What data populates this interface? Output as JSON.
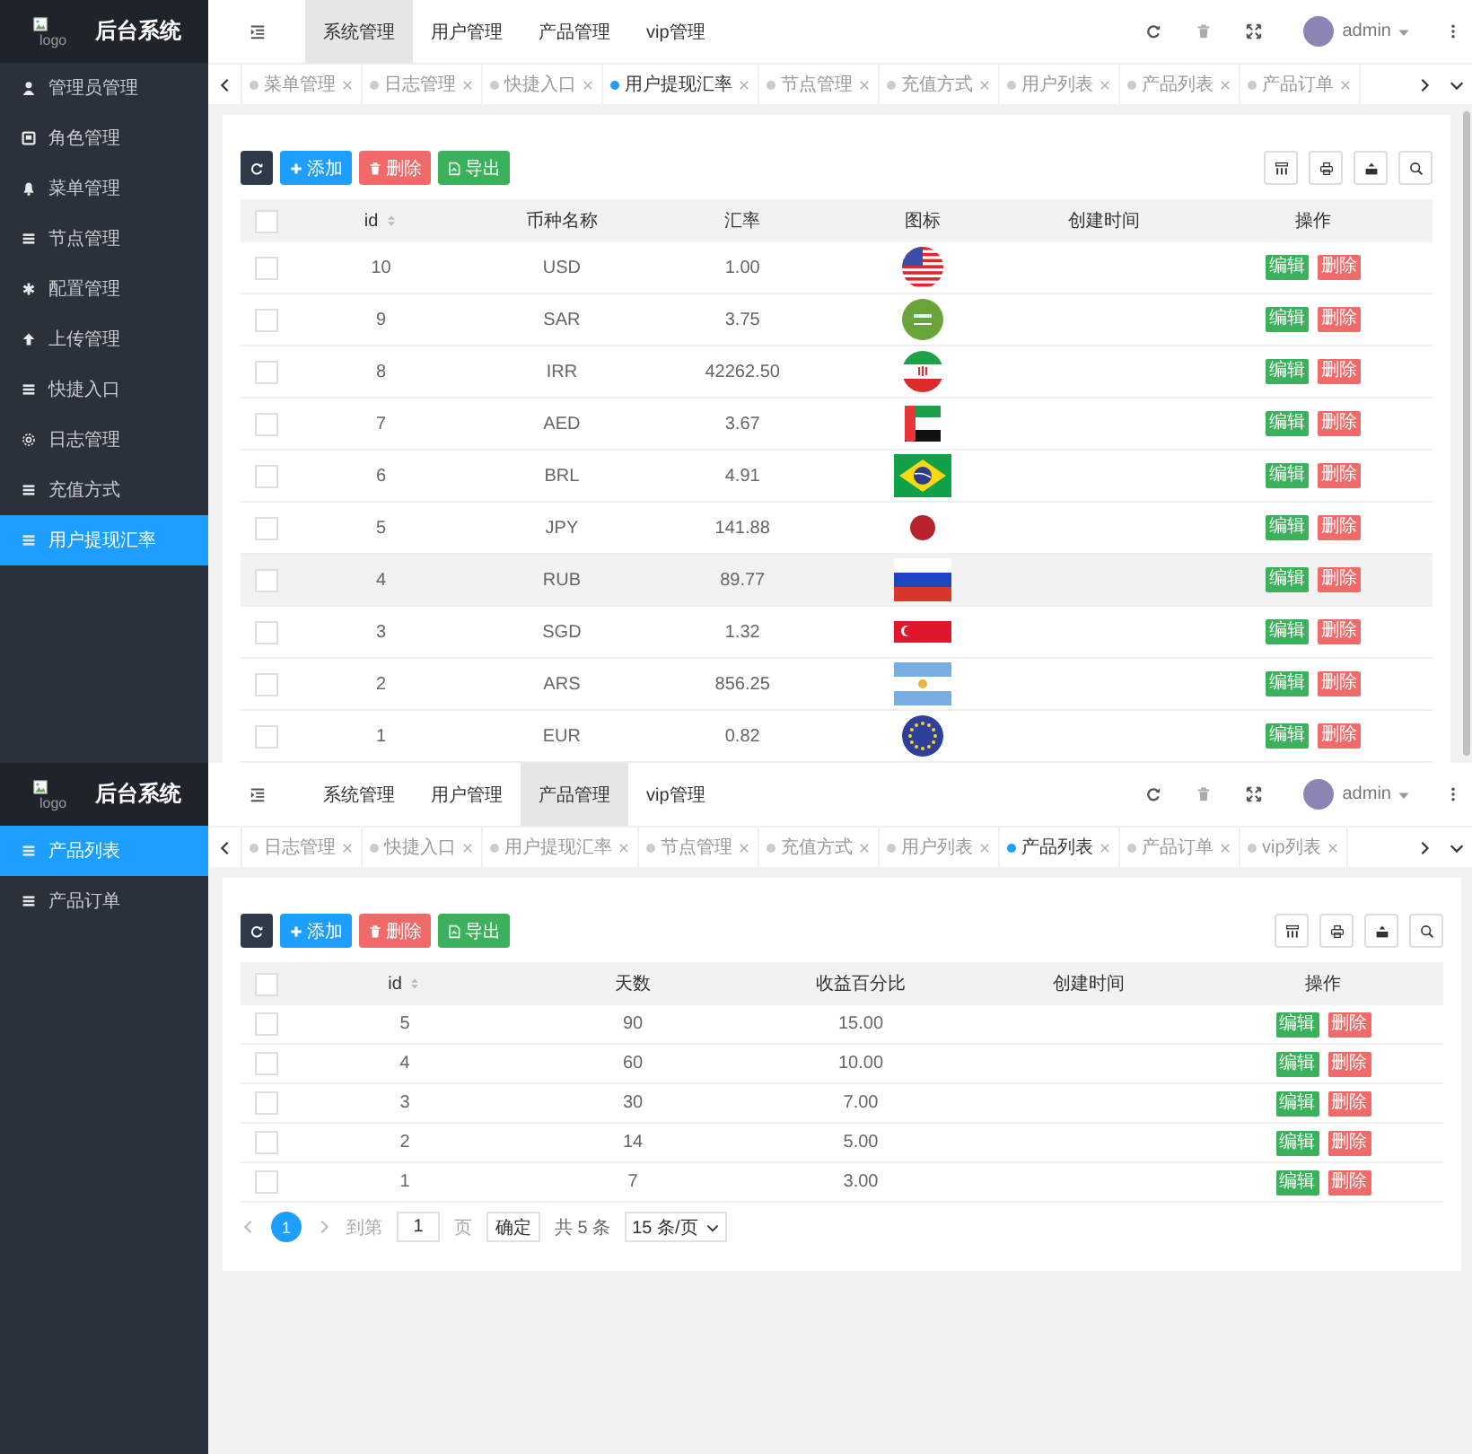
{
  "screens": [
    {
      "brand": {
        "logo_alt": "logo",
        "title": "后台系统"
      },
      "top_nav": [
        {
          "label": "系统管理",
          "selected": true
        },
        {
          "label": "用户管理",
          "selected": false
        },
        {
          "label": "产品管理",
          "selected": false
        },
        {
          "label": "vip管理",
          "selected": false
        }
      ],
      "user": {
        "name": "admin"
      },
      "sidebar": {
        "items": [
          {
            "label": "管理员管理",
            "selected": false
          },
          {
            "label": "角色管理",
            "selected": false
          },
          {
            "label": "菜单管理",
            "selected": false
          },
          {
            "label": "节点管理",
            "selected": false
          },
          {
            "label": "配置管理",
            "selected": false
          },
          {
            "label": "上传管理",
            "selected": false
          },
          {
            "label": "快捷入口",
            "selected": false
          },
          {
            "label": "日志管理",
            "selected": false
          },
          {
            "label": "充值方式",
            "selected": false
          },
          {
            "label": "用户提现汇率",
            "selected": true
          }
        ]
      },
      "tabs": [
        {
          "label": "菜单管理",
          "selected": false
        },
        {
          "label": "日志管理",
          "selected": false
        },
        {
          "label": "快捷入口",
          "selected": false
        },
        {
          "label": "用户提现汇率",
          "selected": true
        },
        {
          "label": "节点管理",
          "selected": false
        },
        {
          "label": "充值方式",
          "selected": false
        },
        {
          "label": "用户列表",
          "selected": false
        },
        {
          "label": "产品列表",
          "selected": false
        },
        {
          "label": "产品订单",
          "selected": false
        }
      ],
      "toolbar": {
        "buttons": [
          {
            "label": "添加",
            "kind": "add"
          },
          {
            "label": "删除",
            "kind": "delete"
          },
          {
            "label": "导出",
            "kind": "export"
          }
        ]
      },
      "table": {
        "select_all": false,
        "columns": [
          {
            "label": "id",
            "kind": "id"
          },
          {
            "label": "币种名称",
            "kind": "text"
          },
          {
            "label": "汇率",
            "kind": "text"
          },
          {
            "label": "图标",
            "kind": "flag"
          },
          {
            "label": "创建时间",
            "kind": "date"
          },
          {
            "label": "操作",
            "kind": "actions"
          }
        ],
        "rows": [
          {
            "cells": [
              "10",
              "USD",
              "1.00"
            ],
            "checked": false,
            "highlighted": false,
            "actions": [
              "编辑",
              "删除"
            ]
          },
          {
            "cells": [
              "9",
              "SAR",
              "3.75"
            ],
            "checked": false,
            "highlighted": false,
            "actions": [
              "编辑",
              "删除"
            ]
          },
          {
            "cells": [
              "8",
              "IRR",
              "42262.50"
            ],
            "checked": false,
            "highlighted": false,
            "actions": [
              "编辑",
              "删除"
            ]
          },
          {
            "cells": [
              "7",
              "AED",
              "3.67"
            ],
            "checked": false,
            "highlighted": false,
            "actions": [
              "编辑",
              "删除"
            ]
          },
          {
            "cells": [
              "6",
              "BRL",
              "4.91"
            ],
            "checked": false,
            "highlighted": false,
            "actions": [
              "编辑",
              "删除"
            ]
          },
          {
            "cells": [
              "5",
              "JPY",
              "141.88"
            ],
            "checked": false,
            "highlighted": false,
            "actions": [
              "编辑",
              "删除"
            ]
          },
          {
            "cells": [
              "4",
              "RUB",
              "89.77"
            ],
            "checked": false,
            "highlighted": true,
            "actions": [
              "编辑",
              "删除"
            ]
          },
          {
            "cells": [
              "3",
              "SGD",
              "1.32"
            ],
            "checked": false,
            "highlighted": false,
            "actions": [
              "编辑",
              "删除"
            ]
          },
          {
            "cells": [
              "2",
              "ARS",
              "856.25"
            ],
            "checked": false,
            "highlighted": false,
            "actions": [
              "编辑",
              "删除"
            ]
          },
          {
            "cells": [
              "1",
              "EUR",
              "0.82"
            ],
            "checked": false,
            "highlighted": false,
            "actions": [
              "编辑",
              "删除"
            ]
          }
        ]
      }
    },
    {
      "brand": {
        "logo_alt": "logo",
        "title": "后台系统"
      },
      "top_nav": [
        {
          "label": "系统管理",
          "selected": false
        },
        {
          "label": "用户管理",
          "selected": false
        },
        {
          "label": "产品管理",
          "selected": true
        },
        {
          "label": "vip管理",
          "selected": false
        }
      ],
      "user": {
        "name": "admin"
      },
      "sidebar": {
        "items": [
          {
            "label": "产品列表",
            "selected": true
          },
          {
            "label": "产品订单",
            "selected": false
          }
        ]
      },
      "tabs": [
        {
          "label": "日志管理",
          "selected": false
        },
        {
          "label": "快捷入口",
          "selected": false
        },
        {
          "label": "用户提现汇率",
          "selected": false
        },
        {
          "label": "节点管理",
          "selected": false
        },
        {
          "label": "充值方式",
          "selected": false
        },
        {
          "label": "用户列表",
          "selected": false
        },
        {
          "label": "产品列表",
          "selected": true
        },
        {
          "label": "产品订单",
          "selected": false
        },
        {
          "label": "vip列表",
          "selected": false
        }
      ],
      "toolbar": {
        "buttons": [
          {
            "label": "添加",
            "kind": "add"
          },
          {
            "label": "删除",
            "kind": "delete"
          },
          {
            "label": "导出",
            "kind": "export"
          }
        ]
      },
      "table": {
        "select_all": false,
        "columns": [
          {
            "label": "id",
            "kind": "id"
          },
          {
            "label": "天数",
            "kind": "text"
          },
          {
            "label": "收益百分比",
            "kind": "text"
          },
          {
            "label": "创建时间",
            "kind": "date"
          },
          {
            "label": "操作",
            "kind": "actions"
          }
        ],
        "rows": [
          {
            "cells": [
              "5",
              "90",
              "15.00"
            ],
            "checked": false,
            "highlighted": false,
            "actions": [
              "编辑",
              "删除"
            ]
          },
          {
            "cells": [
              "4",
              "60",
              "10.00"
            ],
            "checked": false,
            "highlighted": false,
            "actions": [
              "编辑",
              "删除"
            ]
          },
          {
            "cells": [
              "3",
              "30",
              "7.00"
            ],
            "checked": false,
            "highlighted": false,
            "actions": [
              "编辑",
              "删除"
            ]
          },
          {
            "cells": [
              "2",
              "14",
              "5.00"
            ],
            "checked": false,
            "highlighted": false,
            "actions": [
              "编辑",
              "删除"
            ]
          },
          {
            "cells": [
              "1",
              "7",
              "3.00"
            ],
            "checked": false,
            "highlighted": false,
            "actions": [
              "编辑",
              "删除"
            ]
          }
        ]
      },
      "pagination": {
        "pages": [
          {
            "label": "1",
            "selected": true
          }
        ],
        "goto_label": "到第",
        "page_input": "1",
        "page_unit": "页",
        "confirm": "确定",
        "total": "共 5 条",
        "page_size": "15 条/页"
      }
    }
  ]
}
